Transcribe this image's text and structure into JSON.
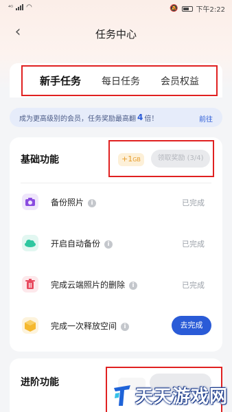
{
  "status_bar": {
    "left_signal": "⁴ᴳ",
    "time": "下午2:22"
  },
  "header": {
    "title": "任务中心"
  },
  "tabs": [
    {
      "label": "新手任务",
      "active": true
    },
    {
      "label": "每日任务",
      "active": false
    },
    {
      "label": "会员权益",
      "active": false
    }
  ],
  "banner": {
    "text_before": "成为更高级别的会员，任务奖励最高翻",
    "multiplier": "4",
    "text_after": "倍！",
    "link": "前往"
  },
  "basic_section": {
    "title": "基础功能",
    "reward": "+1",
    "reward_unit": "GB",
    "claim_label": "领取奖励 (3/4)",
    "tasks": [
      {
        "name": "备份照片",
        "icon": "camera-icon",
        "color": "#8a4be0",
        "status": "已完成"
      },
      {
        "name": "开启自动备份",
        "icon": "cloud-icon",
        "color": "#2fc7a0",
        "status": "已完成"
      },
      {
        "name": "完成云端照片的删除",
        "icon": "trash-icon",
        "color": "#e84a5f",
        "status": "已完成"
      },
      {
        "name": "完成一次释放空间",
        "icon": "box-icon",
        "color": "#f5b82e",
        "action": "去完成"
      }
    ]
  },
  "advanced_section": {
    "title": "进阶功能"
  },
  "watermark": {
    "text": "天天游戏网"
  },
  "colors": {
    "accent_blue": "#2a5bd7",
    "highlight_red": "#e02020"
  }
}
